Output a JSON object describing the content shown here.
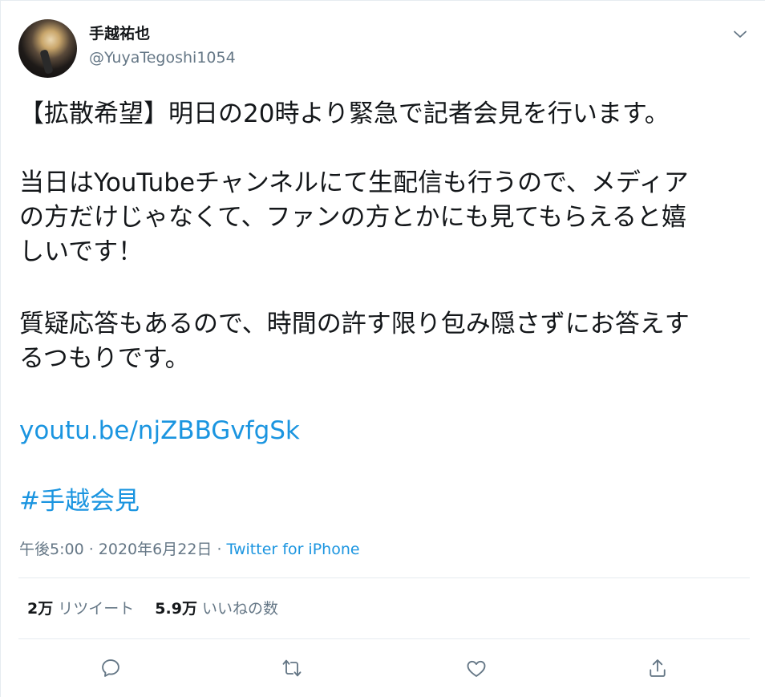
{
  "author": {
    "display_name": "手越祐也",
    "handle": "@YuyaTegoshi1054"
  },
  "tweet": {
    "line1": "【拡散希望】明日の20時より緊急で記者会見を行います。",
    "para2_line1": "当日はYouTubeチャンネルにて生配信も行うので、メディア",
    "para2_line2": "の方だけじゃなくて、ファンの方とかにも見てもらえると嬉",
    "para2_line3": "しいです！",
    "para3_line1": "質疑応答もあるので、時間の許す限り包み隠さずにお答えす",
    "para3_line2": "るつもりです。",
    "link": "youtu.be/njZBBGvfgSk",
    "hashtag": "#手越会見"
  },
  "meta": {
    "time": "午後5:00 · 2020年6月22日 · ",
    "source": "Twitter for iPhone"
  },
  "stats": {
    "retweet_count": "2万",
    "retweet_label": "リツイート",
    "like_count": "5.9万",
    "like_label": "いいねの数"
  },
  "icons": {
    "caret": "chevron-down-icon",
    "reply": "reply-icon",
    "retweet": "retweet-icon",
    "like": "heart-icon",
    "share": "share-icon"
  },
  "colors": {
    "link": "#1b95e0",
    "muted": "#657786",
    "text": "#14171a",
    "border": "#e6ecf0"
  }
}
